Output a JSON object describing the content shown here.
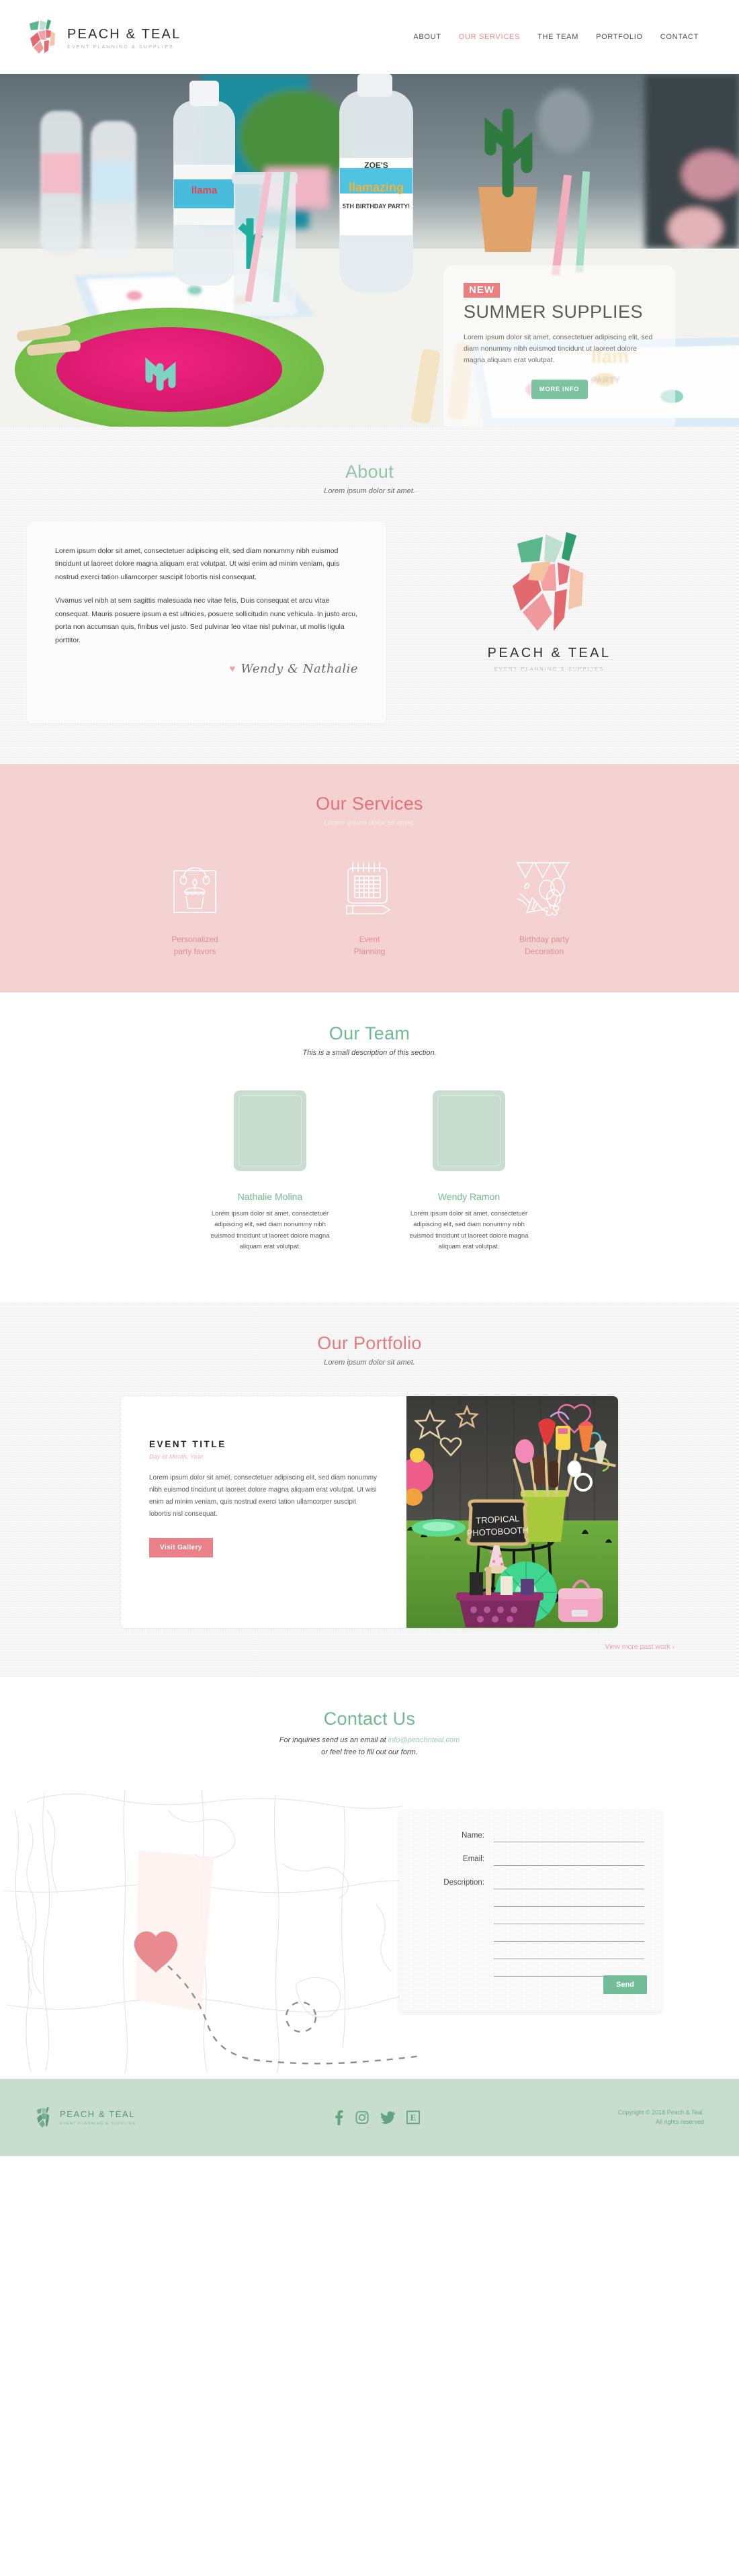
{
  "brand": {
    "name": "PEACH & TEAL",
    "tagline": "EVENT PLANNING & SUPPLIES",
    "accent_peach": "#e9807f",
    "accent_teal": "#7cc3a0",
    "services_bg": "#f4d2d2",
    "footer_bg": "#c7ddce"
  },
  "nav": {
    "items": [
      {
        "label": "ABOUT",
        "active": false
      },
      {
        "label": "OUR SERVICES",
        "active": true
      },
      {
        "label": "THE TEAM",
        "active": false
      },
      {
        "label": "PORTFOLIO",
        "active": false
      },
      {
        "label": "CONTACT",
        "active": false
      }
    ]
  },
  "hero": {
    "badge": "NEW",
    "title": "SUMMER SUPPLIES",
    "description": "Lorem ipsum dolor sit amet, consectetuer adipiscing elit, sed diam nonummy nibh euismod tincidunt ut laoreet dolore magna aliquam erat volutpat.",
    "button": "MORE INFO"
  },
  "about": {
    "title": "About",
    "subtitle": "Lorem ipsum dolor sit amet.",
    "paragraph1": "Lorem ipsum dolor sit amet, consectetuer adipiscing elit, sed diam nonummy nibh euismod tincidunt ut laoreet dolore magna aliquam erat volutpat. Ut wisi enim ad minim veniam, quis nostrud exerci tation ullamcorper suscipit lobortis nisl consequat.",
    "paragraph2": "Vivamus vel nibh at sem sagittis malesuada nec vitae felis. Duis consequat et arcu vitae consequat. Mauris posuere ipsum a est ultricies, posuere sollicitudin nunc vehicula. In justo arcu, porta non accumsan quis, finibus vel justo. Sed pulvinar leo vitae nisl pulvinar, ut mollis ligula porttitor.",
    "signature": "Wendy & Nathalie",
    "signature_heart": "♥",
    "logo_name": "PEACH & TEAL",
    "logo_sub": "EVENT PLANNING & SUPPLIES"
  },
  "services": {
    "title": "Our Services",
    "subtitle": "Lorem ipsum dolor sit amet.",
    "items": [
      {
        "icon": "gift-bag-cupcake-icon",
        "label": "Personalized\nparty favors"
      },
      {
        "icon": "calendar-pencil-icon",
        "label": "Event\nPlanning"
      },
      {
        "icon": "balloons-bunting-icon",
        "label": "Birthday party\nDecoration"
      }
    ]
  },
  "team": {
    "title": "Our Team",
    "subtitle": "This is a small description of this section.",
    "members": [
      {
        "name": "Nathalie Molina",
        "bio": "Lorem ipsum dolor sit amet, consectetuer adipiscing elit, sed diam nonummy nibh euismod tincidunt ut laoreet dolore magna aliquam erat volutpat."
      },
      {
        "name": "Wendy Ramon",
        "bio": "Lorem ipsum dolor sit amet, consectetuer adipiscing elit, sed diam nonummy nibh euismod tincidunt ut laoreet dolore magna aliquam erat volutpat."
      }
    ]
  },
  "portfolio": {
    "title": "Our Portfolio",
    "subtitle": "Lorem ipsum dolor sit amet.",
    "event_title": "EVENT TITLE",
    "event_date": "Day of Month, Year",
    "event_desc": "Lorem ipsum dolor sit amet, consectetuer adipiscing elit, sed diam nonummy nibh euismod tincidunt ut laoreet dolore magna aliquam erat volutpat. Ut wisi enim ad minim veniam, quis nostrud exerci tation ullamcorper suscipit lobortis nisl consequat.",
    "button": "Visit Gallery",
    "more_link": "View more past work ›",
    "photo_chalkboard_text": "TROPICAL PHOTOBOOTH"
  },
  "contact": {
    "title": "Contact Us",
    "intro_prefix": "For inquiries send us an email at ",
    "email": "info@peachnteal.com",
    "intro_suffix": "or feel free to fill out our form.",
    "form": {
      "name_label": "Name:",
      "email_label": "Email:",
      "description_label": "Description:",
      "name_value": "",
      "email_value": "",
      "description_value": "",
      "send_button": "Send"
    }
  },
  "footer": {
    "name": "PEACH & TEAL",
    "tagline": "EVENT PLANNING & SUPPLIES",
    "social": [
      "facebook-icon",
      "instagram-icon",
      "twitter-icon",
      "etsy-icon"
    ],
    "copyright_line1": "Copyright © 2018 Peach & Teal.",
    "copyright_line2": "All rights reserved"
  }
}
